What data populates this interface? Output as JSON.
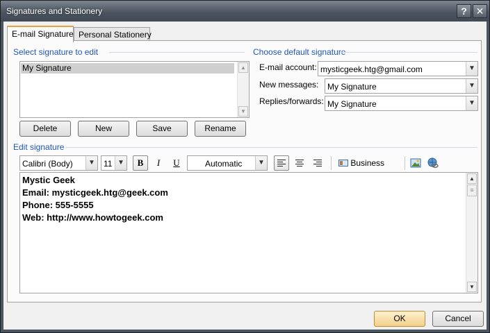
{
  "window": {
    "title": "Signatures and Stationery",
    "help_glyph": "?",
    "close_glyph": "✕"
  },
  "tabs": [
    {
      "label": "E-mail Signature",
      "active": true
    },
    {
      "label": "Personal Stationery",
      "active": false
    }
  ],
  "select_section": {
    "label": "Select signature to edit",
    "items": [
      "My Signature"
    ],
    "selected": "My Signature"
  },
  "buttons": {
    "delete": "Delete",
    "new": "New",
    "save": "Save",
    "rename": "Rename",
    "ok": "OK",
    "cancel": "Cancel"
  },
  "default_section": {
    "label": "Choose default signature",
    "email_account_label": "E-mail account:",
    "email_account_value": "mysticgeek.htg@gmail.com",
    "new_messages_label": "New messages:",
    "new_messages_value": "My Signature",
    "replies_label": "Replies/forwards:",
    "replies_value": "My Signature"
  },
  "edit_section": {
    "label": "Edit signature",
    "font": "Calibri (Body)",
    "size": "11",
    "bold": "B",
    "italic": "I",
    "underline": "U",
    "color": "Automatic",
    "business_card": "Business Card"
  },
  "signature_lines": [
    "Mystic Geek",
    "Email: mysticgeek.htg@geek.com",
    "Phone: 555-5555",
    "Web: http://www.howtogeek.com"
  ],
  "colors": {
    "section_label": "#1f56b8",
    "title_bar": "#4c5560",
    "focus_accent": "#e8a33d"
  }
}
